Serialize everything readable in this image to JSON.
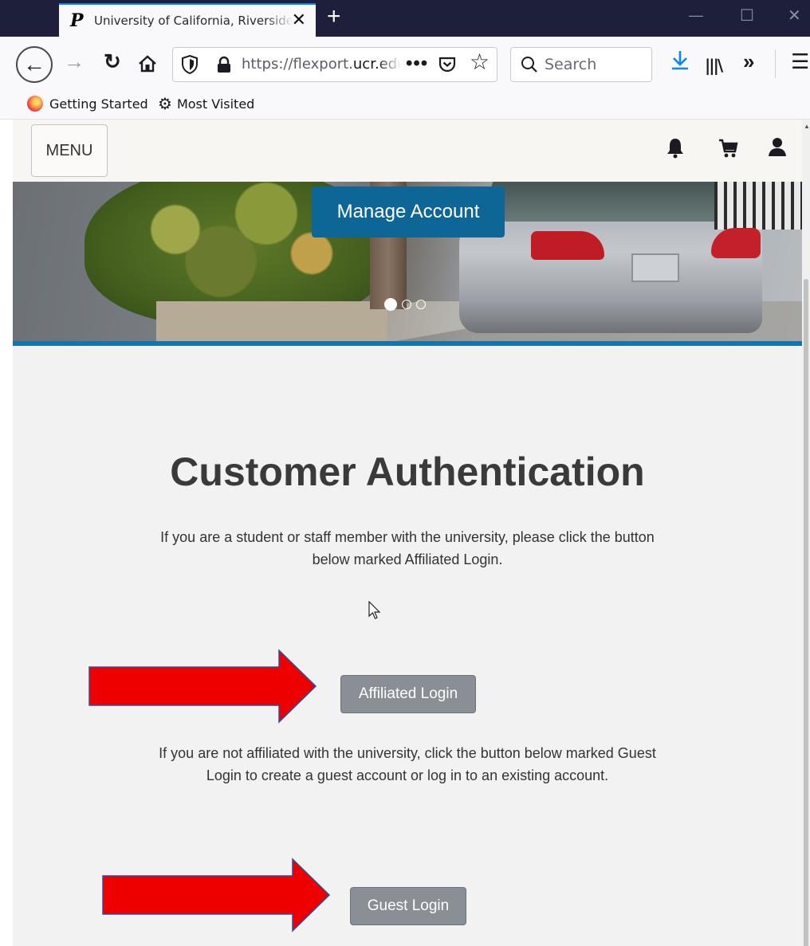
{
  "browser": {
    "tab_title": "University of California, Riverside",
    "url_prefix": "https://flexport.",
    "url_domain": "ucr.edu",
    "search_placeholder": "Search",
    "bookmarks": [
      "Getting Started",
      "Most Visited"
    ]
  },
  "site": {
    "menu_label": "MENU",
    "hero_button": "Manage Account",
    "carousel_slides": 3,
    "carousel_active": 1
  },
  "auth": {
    "title": "Customer Authentication",
    "affiliated_text": "If you are a student or staff member with the university, please click the button below marked Affiliated Login.",
    "affiliated_button": "Affiliated Login",
    "guest_text": "If you are not affiliated with the university, click the button below marked Guest Login to create a guest account or log in to an existing account.",
    "guest_button": "Guest Login"
  },
  "colors": {
    "accent_blue": "#0e6696",
    "button_gray": "#8a8f96",
    "arrow_red": "#ee0000"
  }
}
